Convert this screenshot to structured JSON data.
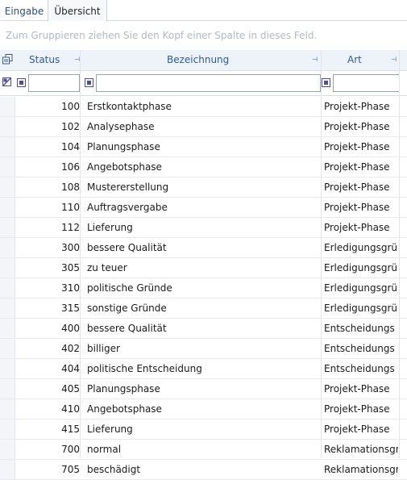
{
  "tabs": [
    {
      "label": "Eingabe"
    },
    {
      "label": "Übersicht"
    }
  ],
  "group_panel_hint": "Zum Gruppieren ziehen Sie den Kopf einer Spalte in dieses Feld.",
  "columns": [
    {
      "label": "Status"
    },
    {
      "label": "Bezeichnung"
    },
    {
      "label": "Art"
    }
  ],
  "rows": [
    {
      "status": "100",
      "bezeichnung": "Erstkontaktphase",
      "art": "Projekt-Phase"
    },
    {
      "status": "102",
      "bezeichnung": "Analysephase",
      "art": "Projekt-Phase"
    },
    {
      "status": "104",
      "bezeichnung": "Planungsphase",
      "art": "Projekt-Phase"
    },
    {
      "status": "106",
      "bezeichnung": "Angebotsphase",
      "art": "Projekt-Phase"
    },
    {
      "status": "108",
      "bezeichnung": "Mustererstellung",
      "art": "Projekt-Phase"
    },
    {
      "status": "110",
      "bezeichnung": "Auftragsvergabe",
      "art": "Projekt-Phase"
    },
    {
      "status": "112",
      "bezeichnung": "Lieferung",
      "art": "Projekt-Phase"
    },
    {
      "status": "300",
      "bezeichnung": "bessere Qualität",
      "art": "Erledigungsgrü"
    },
    {
      "status": "305",
      "bezeichnung": "zu teuer",
      "art": "Erledigungsgrü"
    },
    {
      "status": "310",
      "bezeichnung": "politische Gründe",
      "art": "Erledigungsgrü"
    },
    {
      "status": "315",
      "bezeichnung": "sonstige Gründe",
      "art": "Erledigungsgrü"
    },
    {
      "status": "400",
      "bezeichnung": "bessere Qualität",
      "art": "Entscheidungs"
    },
    {
      "status": "402",
      "bezeichnung": "billiger",
      "art": "Entscheidungs"
    },
    {
      "status": "404",
      "bezeichnung": "politische Entscheidung",
      "art": "Entscheidungs"
    },
    {
      "status": "405",
      "bezeichnung": "Planungsphase",
      "art": "Projekt-Phase"
    },
    {
      "status": "410",
      "bezeichnung": "Angebotsphase",
      "art": "Projekt-Phase"
    },
    {
      "status": "415",
      "bezeichnung": "Lieferung",
      "art": "Projekt-Phase"
    },
    {
      "status": "700",
      "bezeichnung": "normal",
      "art": "Reklamationsgr"
    },
    {
      "status": "705",
      "bezeichnung": "beschädigt",
      "art": "Reklamationsgr"
    }
  ]
}
